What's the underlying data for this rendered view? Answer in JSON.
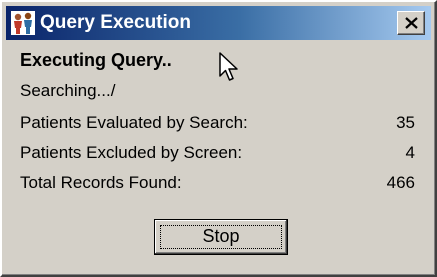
{
  "window": {
    "title": "Query Execution",
    "icon": "patients-icon",
    "close_icon": "close-icon"
  },
  "progress": {
    "heading": "Executing Query..",
    "status": "Searching.../"
  },
  "stats": [
    {
      "label": "Patients Evaluated by Search:",
      "value": "35"
    },
    {
      "label": "Patients Excluded by Screen:",
      "value": "4"
    },
    {
      "label": "Total Records Found:",
      "value": "466"
    }
  ],
  "actions": {
    "stop_label": "Stop"
  },
  "colors": {
    "face": "#d4d0c8",
    "title_start": "#0a246a",
    "title_end": "#a6caf0"
  }
}
